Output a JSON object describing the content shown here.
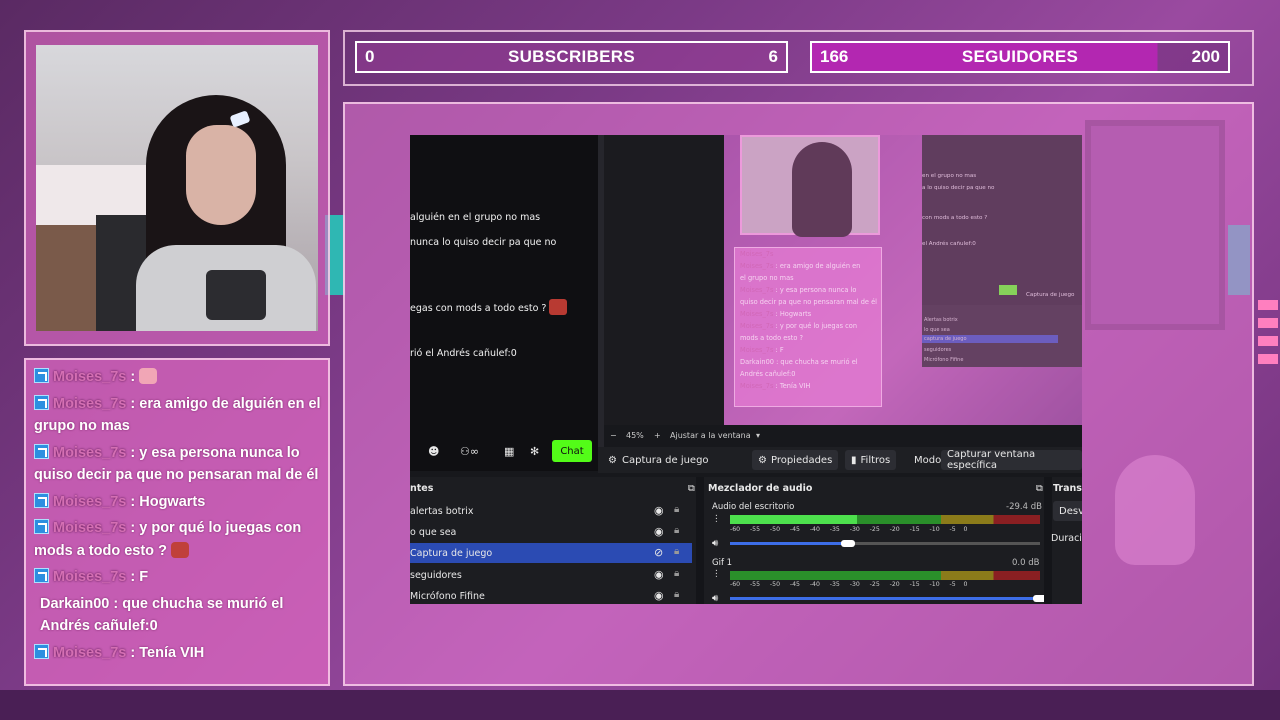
{
  "counters": {
    "subscribers": {
      "current": "0",
      "label": "SUBSCRIBERS",
      "goal": "6",
      "progress": 0
    },
    "followers": {
      "current": "166",
      "label": "SEGUIDORES",
      "goal": "200",
      "progress": 0.83
    }
  },
  "chat": {
    "messages": [
      {
        "user": "Moises_7s",
        "text": "",
        "emote": "pig-emote"
      },
      {
        "user": "Moises_7s",
        "text": "era amigo de alguién en el grupo no mas"
      },
      {
        "user": "Moises_7s",
        "text": "y esa persona nunca lo quiso decir pa que no pensaran mal de él"
      },
      {
        "user": "Moises_7s",
        "text": "Hogwarts"
      },
      {
        "user": "Moises_7s",
        "text": "y por qué lo juegas con mods a todo esto ?",
        "emote": "red-face-emote"
      },
      {
        "user": "Moises_7s",
        "text": "F"
      },
      {
        "user": "Darkain00",
        "text": "que chucha se murió el Andrés cañulef:0"
      },
      {
        "user": "Moises_7s",
        "text": "Tenía VIH"
      }
    ],
    "separator": " : "
  },
  "capture": {
    "chat_lines": [
      "alguién en el grupo no mas",
      "nunca lo quiso decir pa que no",
      "egas con mods a todo esto ?",
      "rió el Andrés cañulef:0"
    ],
    "chat_button": "Chat",
    "zoom": "45%",
    "fit_label": "Ajustar a la ventana",
    "source_name": "Captura de juego",
    "properties_label": "Propiedades",
    "filters_label": "Filtros",
    "mode_label": "Modo",
    "mode_value": "Capturar ventana específica",
    "preview_chat": [
      {
        "user": "Moises_7s",
        "text": ""
      },
      {
        "user": "Moises_7s",
        "text": "era amigo de alguién en"
      },
      {
        "user": "",
        "text": "el grupo no mas"
      },
      {
        "user": "Moises_7s",
        "text": "y esa persona nunca lo"
      },
      {
        "user": "",
        "text": "quiso decir pa que no pensaran mal de él"
      },
      {
        "user": "Moises_7s",
        "text": "Hogwarts"
      },
      {
        "user": "Moises_7s",
        "text": "y por qué lo juegas con"
      },
      {
        "user": "",
        "text": "mods a todo esto ?"
      },
      {
        "user": "Moises_7s",
        "text": "F"
      },
      {
        "user": "",
        "text": "Darkain00 : que chucha se murió el"
      },
      {
        "user": "",
        "text": "Andrés cañulef:0"
      },
      {
        "user": "Moises_7s",
        "text": "Tenía VIH"
      }
    ],
    "mini_lines": [
      "en el grupo no mas",
      "a lo quiso decir pa que no",
      "con mods a todo esto ?",
      "el Andrés cañulef:0",
      "Captura de juego",
      "Alertas botrix",
      "lo que sea",
      "captura de juego",
      "seguidores",
      "Micrófono Fifine"
    ],
    "sources_title": "ntes",
    "sources": [
      {
        "name": "alertas botrix",
        "selected": false
      },
      {
        "name": "o que sea",
        "selected": false
      },
      {
        "name": "Captura de juego",
        "selected": true
      },
      {
        "name": "seguidores",
        "selected": false
      },
      {
        "name": "Micrófono Fifine",
        "selected": false
      }
    ],
    "mixer_title": "Mezclador de audio",
    "mixer": [
      {
        "name": "Audio del escritorio",
        "db": "-29.4 dB",
        "level": 0.41,
        "volume": 0.38
      },
      {
        "name": "Gif 1",
        "db": "0.0 dB",
        "level": 0,
        "volume": 1.0
      }
    ],
    "ticks": [
      "-60",
      "-55",
      "-50",
      "-45",
      "-40",
      "-35",
      "-30",
      "-25",
      "-20",
      "-15",
      "-10",
      "-5",
      "0"
    ],
    "transitions_title": "Transi",
    "transition_value": "Desva",
    "duration_label": "Duració"
  },
  "colors": {
    "mod_badge": "#2d8fe0",
    "kick_green": "#53fc18",
    "obs_selected": "#2b4bb3",
    "followers_bar": "#b327b1"
  }
}
